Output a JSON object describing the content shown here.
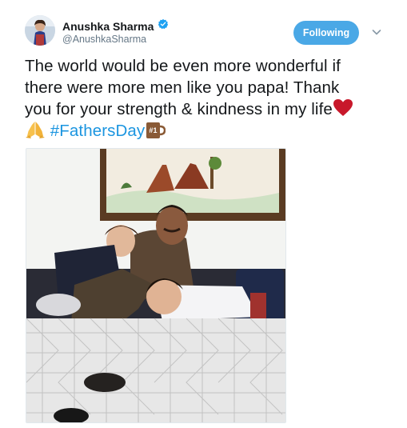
{
  "user": {
    "display_name": "Anushka Sharma",
    "handle": "@AnushkaSharma",
    "verified": true,
    "verified_icon": "verified-badge-icon"
  },
  "follow": {
    "label": "Following"
  },
  "tweet": {
    "line1": "The world would be even more wonderful if",
    "line2": "there were more men like you papa! Thank",
    "line3": "you for your strength & kindness in my life",
    "hashtag": "#FathersDay",
    "emojis": [
      "red-heart-icon",
      "folded-hands-icon",
      "number-one-mug-icon"
    ]
  },
  "media": {
    "type": "photo",
    "badge_text": "#1"
  },
  "colors": {
    "accent": "#1b95e0",
    "follow_button": "#4aa8e6",
    "text": "#14171a",
    "secondary_text": "#657786"
  }
}
